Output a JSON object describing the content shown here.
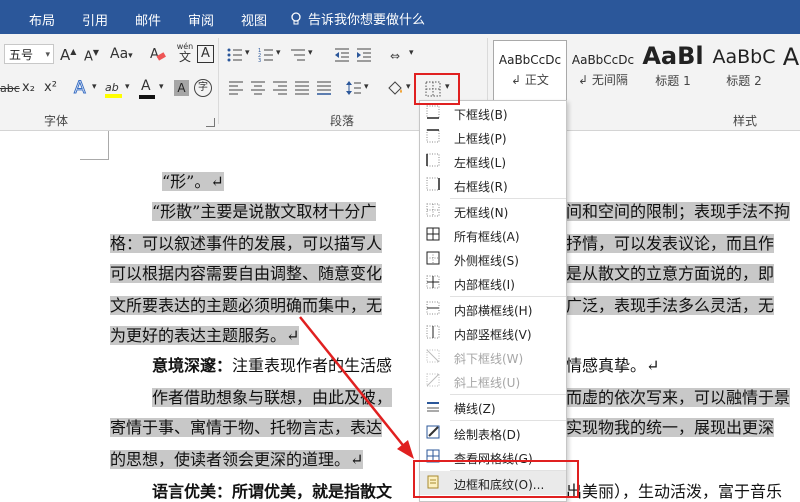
{
  "tabs": [
    "布局",
    "引用",
    "邮件",
    "审阅",
    "视图"
  ],
  "tell_me": "告诉我你想要做什么",
  "ribbon": {
    "font_size": "五号",
    "font_group_label": "字体",
    "paragraph_group_label": "段落",
    "styles_group_label": "样式",
    "font_btns": {
      "grow": "A",
      "shrink": "A",
      "case": "Aa",
      "pinyin": "wén",
      "border_char": "A",
      "strike": "abc",
      "sub": "x₂",
      "sup": "x²",
      "effects": "A",
      "highlight": "ab",
      "color": "A",
      "shade": "A",
      "enclose": "字"
    }
  },
  "styles": [
    {
      "sample": "AaBbCcDc",
      "name": "正文"
    },
    {
      "sample": "AaBbCcDc",
      "name": "无间隔"
    },
    {
      "sample": "AaBl",
      "name": "标题 1"
    },
    {
      "sample": "AaBbC",
      "name": "标题 2"
    },
    {
      "sample": "A",
      "name": ""
    }
  ],
  "document": {
    "lines": [
      "“形”。↵",
      "“形散”主要是说散文取材十分广",
      "格：可以叙述事件的发展，可以描写人",
      "可以根据内容需要自由调整、随意变化",
      "文所要表达的主题必须明确而集中，无",
      "为更好的表达主题服务。↵",
      "作者借助想象与联想，由此及彼，",
      "寄情于事、寓情于物、托物言志，表达",
      "的思想，使读者领会更深的道理。↵",
      "语言优美：所谓优美，就是指散文"
    ],
    "right_fragments": [
      "间和空间的限制；表现手法不拘",
      "抒情，可以发表议论，而且作",
      "是从散文的立意方面说的，即",
      "广泛，表现手法多么灵活，无",
      "实现物我的统一，展现出更深",
      "出美丽），生动活泼，富于音乐"
    ],
    "fragments": {
      "yijing_label": "意境深邃：",
      "yijing_text": "注重表现作者的生活感",
      "qinggan": "情感真挚。↵",
      "xu": "而虚的依次写来，可以融情于景"
    }
  },
  "border_menu": {
    "items": [
      {
        "label": "下框线(B)",
        "icon": "bottom-border-icon",
        "disabled": false
      },
      {
        "label": "上框线(P)",
        "icon": "top-border-icon",
        "disabled": false
      },
      {
        "label": "左框线(L)",
        "icon": "left-border-icon",
        "disabled": false
      },
      {
        "label": "右框线(R)",
        "icon": "right-border-icon",
        "disabled": false
      },
      {
        "label": "无框线(N)",
        "icon": "no-border-icon",
        "disabled": false
      },
      {
        "label": "所有框线(A)",
        "icon": "all-borders-icon",
        "disabled": false
      },
      {
        "label": "外侧框线(S)",
        "icon": "outside-borders-icon",
        "disabled": false
      },
      {
        "label": "内部框线(I)",
        "icon": "inside-borders-icon",
        "disabled": false
      },
      {
        "label": "内部横框线(H)",
        "icon": "inside-horizontal-border-icon",
        "disabled": false
      },
      {
        "label": "内部竖框线(V)",
        "icon": "inside-vertical-border-icon",
        "disabled": false
      },
      {
        "label": "斜下框线(W)",
        "icon": "diagonal-down-border-icon",
        "disabled": true
      },
      {
        "label": "斜上框线(U)",
        "icon": "diagonal-up-border-icon",
        "disabled": true
      },
      {
        "label": "横线(Z)",
        "icon": "horizontal-line-icon",
        "disabled": false
      },
      {
        "label": "绘制表格(D)",
        "icon": "draw-table-icon",
        "disabled": false
      },
      {
        "label": "查看网格线(G)",
        "icon": "view-gridlines-icon",
        "disabled": false
      },
      {
        "label": "边框和底纹(O)...",
        "icon": "borders-shading-icon",
        "disabled": false
      }
    ]
  },
  "colors": {
    "tabbar": "#2b579a",
    "highlight": "#c8c8c8",
    "annotation_red": "#e02020"
  }
}
